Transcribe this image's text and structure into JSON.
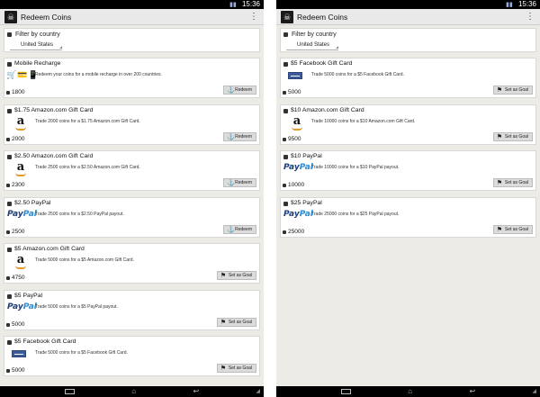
{
  "status": {
    "time": "15:36"
  },
  "appbar": {
    "title": "Redeem Coins",
    "overflow": "⋮"
  },
  "filter": {
    "title": "Filter by country",
    "selected": "United States"
  },
  "left_cards": [
    {
      "title": "Mobile Recharge",
      "logo": "mobile-icons",
      "desc": "Redeem your coins for a mobile recharge in over 200 countries.",
      "price": "1800",
      "action": "Redeem",
      "action_icon": "anchor-icon"
    },
    {
      "title": "$1.75 Amazon.com Gift Card",
      "logo": "amazon",
      "desc": "Trade 2000 coins for a $1.75 Amazon.com Gift Card.",
      "price": "2000",
      "action": "Redeem",
      "action_icon": "anchor-icon"
    },
    {
      "title": "$2.50 Amazon.com Gift Card",
      "logo": "amazon",
      "desc": "Trade 2500 coins for a $2.50 Amazon.com Gift Card.",
      "price": "2300",
      "action": "Redeem",
      "action_icon": "anchor-icon"
    },
    {
      "title": "$2.50 PayPal",
      "logo": "paypal",
      "desc": "Trade 2500 coins for a $2.50 PayPal payout.",
      "price": "2500",
      "action": "Redeem",
      "action_icon": "anchor-icon"
    },
    {
      "title": "$5 Amazon.com Gift Card",
      "logo": "amazon",
      "desc": "Trade 5000 coins for a $5 Amazon.com Gift Card.",
      "price": "4750",
      "action": "Set as Goal",
      "action_icon": "flag-icon"
    },
    {
      "title": "$5 PayPal",
      "logo": "paypal",
      "desc": "Trade 5000 coins for a $5 PayPal payout.",
      "price": "5000",
      "action": "Set as Goal",
      "action_icon": "flag-icon"
    },
    {
      "title": "$5 Facebook Gift Card",
      "logo": "facebook",
      "desc": "Trade 5000 coins for a $5 Facebook Gift Card.",
      "price": "5000",
      "action": "Set as Goal",
      "action_icon": "flag-icon"
    }
  ],
  "right_cards": [
    {
      "title": "$5 Facebook Gift Card",
      "logo": "facebook",
      "desc": "Trade 5000 coins for a $5 Facebook Gift Card.",
      "price": "5000",
      "action": "Set as Goal",
      "action_icon": "flag-icon"
    },
    {
      "title": "$10 Amazon.com Gift Card",
      "logo": "amazon",
      "desc": "Trade 10000 coins for a $10 Amazon.com Gift Card.",
      "price": "9500",
      "action": "Set as Goal",
      "action_icon": "flag-icon"
    },
    {
      "title": "$10 PayPal",
      "logo": "paypal",
      "desc": "Trade 10000 coins for a $10 PayPal payout.",
      "price": "10000",
      "action": "Set as Goal",
      "action_icon": "flag-icon"
    },
    {
      "title": "$25 PayPal",
      "logo": "paypal",
      "desc": "Trade 25000 coins for a $25 PayPal payout.",
      "price": "25000",
      "action": "Set as Goal",
      "action_icon": "flag-icon"
    }
  ],
  "logos": {
    "amazon_letter": "a",
    "paypal_pay": "Pay",
    "paypal_pal": "Pal",
    "mobile_glyphs": "🛒💳📱"
  },
  "icons": {
    "anchor-icon": "⚓",
    "flag-icon": "⚑",
    "back-icon": "↩",
    "home-icon": "⌂"
  }
}
